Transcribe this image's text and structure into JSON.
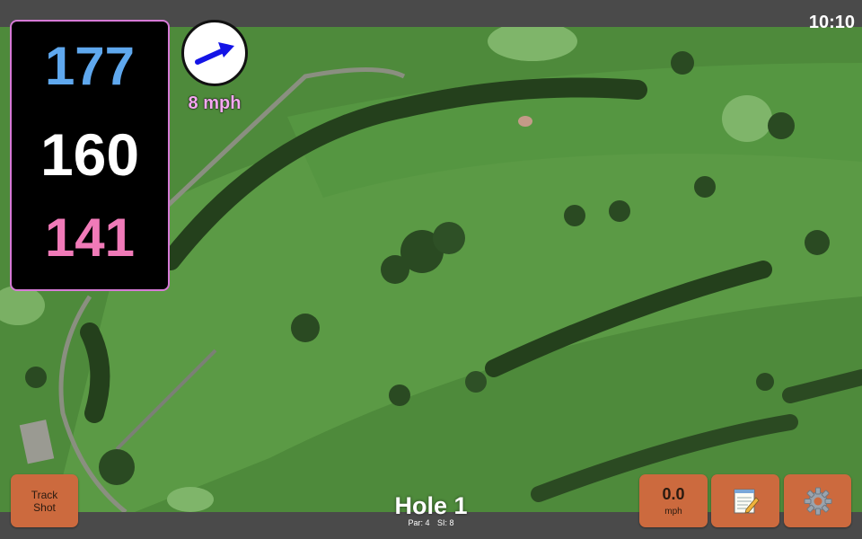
{
  "status": {
    "time": "10:10"
  },
  "distances": {
    "back": "177",
    "middle": "160",
    "front": "141"
  },
  "wind": {
    "speed_label": "8 mph"
  },
  "buttons": {
    "track_shot": "Track Shot",
    "speed_value": "0.0",
    "speed_unit": "mph"
  },
  "hole": {
    "title": "Hole 1",
    "par": "Par: 4",
    "stroke_index": "SI: 8"
  },
  "icons": {
    "wind": "wind-arrow-icon",
    "notes": "notepad-icon",
    "settings": "gear-icon"
  },
  "colors": {
    "distance_back": "#5fa8ee",
    "distance_middle": "#ffffff",
    "distance_front": "#f07ab8",
    "wind_label": "#f4a8f0",
    "button": "#cc6a3e"
  }
}
